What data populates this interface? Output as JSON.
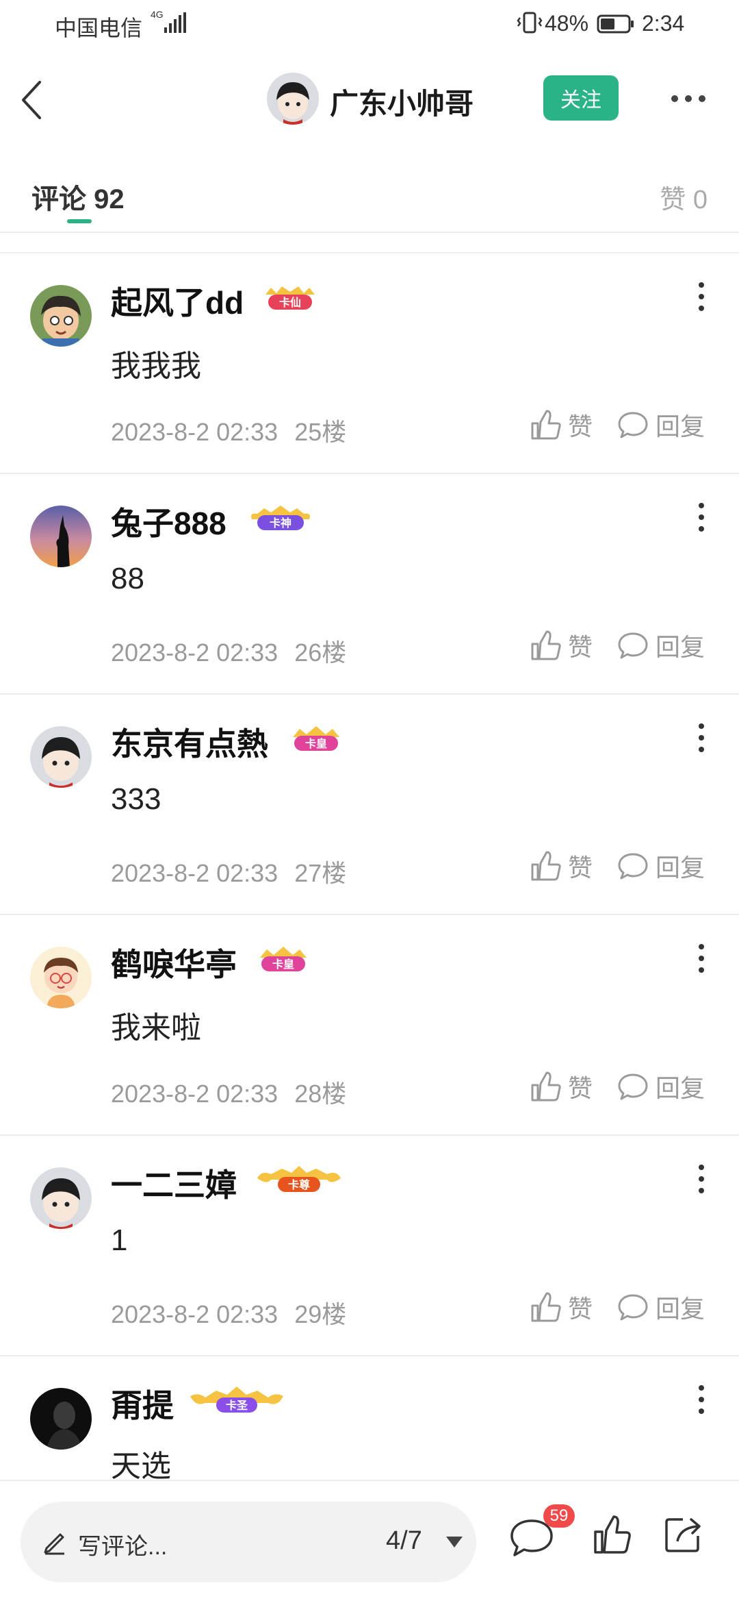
{
  "status_bar": {
    "carrier": "中国电信",
    "network": "4G",
    "battery": "48%",
    "time": "2:34"
  },
  "header": {
    "user_name": "广东小帅哥",
    "follow_label": "关注"
  },
  "tabs": {
    "comments_label": "评论 92",
    "likes_label": "赞 0"
  },
  "comments": [
    {
      "name": "起风了dd",
      "badge": "卡仙",
      "badge_color": "#e8415a",
      "text": "我我我",
      "time": "2023-8-2 02:33",
      "floor": "25楼",
      "like_label": "赞",
      "reply_label": "回复",
      "avatar": "cartoon-boy"
    },
    {
      "name": "兔子888",
      "badge": "卡神",
      "badge_color": "#7b4fe0",
      "text": "88",
      "time": "2023-8-2 02:33",
      "floor": "26楼",
      "like_label": "赞",
      "reply_label": "回复",
      "avatar": "sunset-silhouette"
    },
    {
      "name": "东京有点熱",
      "badge": "卡皇",
      "badge_color": "#e0449a",
      "text": "333",
      "time": "2023-8-2 02:33",
      "floor": "27楼",
      "like_label": "赞",
      "reply_label": "回复",
      "avatar": "default-girl"
    },
    {
      "name": "鹤唳华亭",
      "badge": "卡皇",
      "badge_color": "#e0449a",
      "text": "我来啦",
      "time": "2023-8-2 02:33",
      "floor": "28楼",
      "like_label": "赞",
      "reply_label": "回复",
      "avatar": "cartoon-kid"
    },
    {
      "name": "一二三嫜",
      "badge": "卡尊",
      "badge_color": "#e8541e",
      "text": "1",
      "time": "2023-8-2 02:33",
      "floor": "29楼",
      "like_label": "赞",
      "reply_label": "回复",
      "avatar": "default-girl"
    },
    {
      "name": "甭提",
      "badge": "卡圣",
      "badge_color": "#8a4fe8",
      "text": "天选",
      "time": "",
      "floor": "",
      "like_label": "",
      "reply_label": "",
      "avatar": "dark-portrait"
    }
  ],
  "bottom_bar": {
    "compose_placeholder": "写评论...",
    "page_indicator": "4/7",
    "comment_count": "59"
  },
  "colors": {
    "accent": "#2ab386",
    "badge_red": "#f04a4a"
  }
}
